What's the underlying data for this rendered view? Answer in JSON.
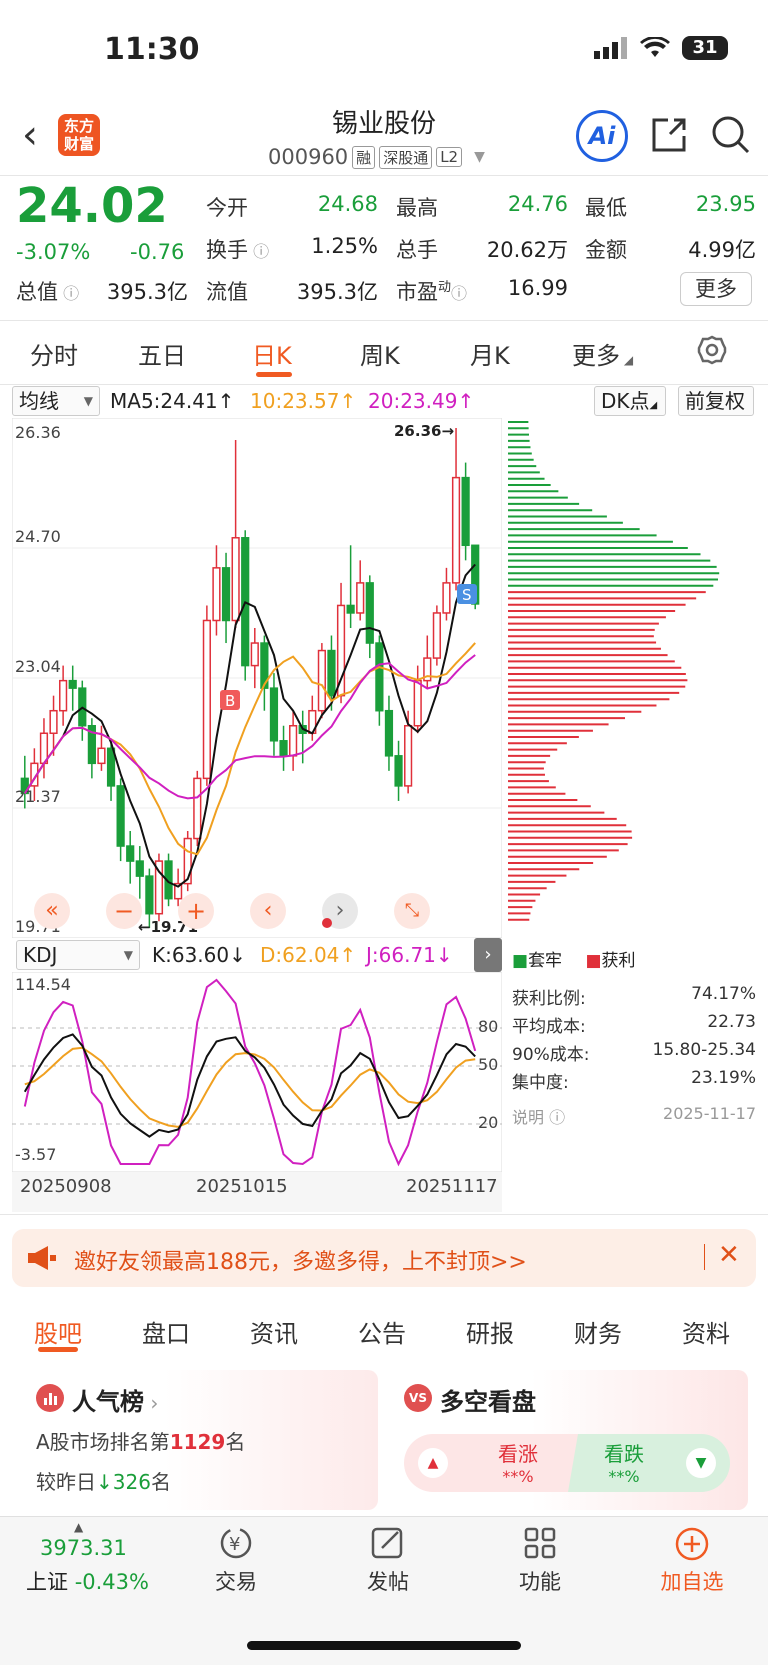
{
  "status": {
    "time": "11:30",
    "battery": "31"
  },
  "header": {
    "logo_line1": "东方",
    "logo_line2": "财富",
    "name": "锡业股份",
    "code": "000960",
    "tags": [
      "融",
      "深股通",
      "L2"
    ],
    "ai_label": "Ai"
  },
  "quote": {
    "price": "24.02",
    "pct": "-3.07%",
    "chg": "-0.76",
    "open_label": "今开",
    "open": "24.68",
    "high_label": "最高",
    "high": "24.76",
    "low_label": "最低",
    "low": "23.95",
    "turnover_label": "换手",
    "turnover": "1.25%",
    "volume_label": "总手",
    "volume": "20.62万",
    "amount_label": "金额",
    "amount": "4.99亿",
    "mktcap_label": "总值",
    "mktcap": "395.3亿",
    "float_label": "流值",
    "float": "395.3亿",
    "pe_label": "市盈",
    "pe_sup": "动",
    "pe": "16.99",
    "more": "更多"
  },
  "period_tabs": [
    "分时",
    "五日",
    "日K",
    "周K",
    "月K",
    "更多"
  ],
  "chart_toolbar": {
    "ma_select": "均线",
    "ma5": "MA5:24.41",
    "ma10": "10:23.57",
    "ma20": "20:23.49",
    "dk": "DK点",
    "adjust": "前复权"
  },
  "kline_axis": {
    "top": "26.36",
    "mid1": "24.70",
    "mid2": "23.04",
    "mid3": "21.37",
    "bottom": "19.71",
    "high_mark": "26.36→",
    "low_mark": "←19.71"
  },
  "kdj": {
    "select": "KDJ",
    "k": "K:63.60",
    "d": "D:62.04",
    "j": "J:66.71",
    "ymax": "114.54",
    "ymin": "-3.57",
    "l80": "80",
    "l50": "50",
    "l20": "20",
    "dates": [
      "20250908",
      "20251015",
      "20251117"
    ]
  },
  "chips": {
    "legend_lock": "套牢",
    "legend_profit": "获利",
    "rows": [
      {
        "label": "获利比例:",
        "value": "74.17%"
      },
      {
        "label": "平均成本:",
        "value": "22.73"
      },
      {
        "label": "90%成本:",
        "value": "15.80-25.34"
      },
      {
        "label": "集中度:",
        "value": "23.19%"
      }
    ],
    "note": "说明",
    "date": "2025-11-17"
  },
  "promo": {
    "text": "邀好友领最高188元，多邀多得，上不封顶>>"
  },
  "bottom_tabs": [
    "股吧",
    "盘口",
    "资讯",
    "公告",
    "研报",
    "财务",
    "资料"
  ],
  "popularity": {
    "title": "人气榜",
    "rank_prefix": "A股市场排名第",
    "rank": "1129",
    "rank_suffix": "名",
    "delta_prefix": "较昨日",
    "delta": "326",
    "delta_suffix": "名"
  },
  "bullbear": {
    "title": "多空看盘",
    "up": "看涨",
    "up_val": "**%",
    "down": "看跌",
    "down_val": "**%"
  },
  "nav": {
    "index_value": "3973.31",
    "index_name": "上证",
    "index_pct": "-0.43%",
    "items": [
      "交易",
      "发帖",
      "功能",
      "加自选"
    ]
  },
  "colors": {
    "up": "#e0303a",
    "down": "#1a9e3a",
    "accent": "#f05a22"
  },
  "chart_data": [
    {
      "type": "candlestick",
      "ylim": [
        19.71,
        26.36
      ],
      "series": [
        {
          "name": "MA5",
          "value": 24.41
        },
        {
          "name": "MA10",
          "value": 23.57
        },
        {
          "name": "MA20",
          "value": 23.49
        }
      ],
      "candles": [
        [
          21.7,
          21.5,
          22.0,
          21.3
        ],
        [
          21.6,
          21.9,
          22.1,
          21.4
        ],
        [
          21.9,
          22.3,
          22.5,
          21.7
        ],
        [
          22.3,
          22.6,
          22.8,
          22.0
        ],
        [
          22.6,
          23.0,
          23.2,
          22.4
        ],
        [
          23.0,
          22.9,
          23.2,
          22.6
        ],
        [
          22.9,
          22.4,
          23.0,
          22.2
        ],
        [
          22.4,
          21.9,
          22.5,
          21.7
        ],
        [
          21.9,
          22.1,
          22.4,
          21.8
        ],
        [
          22.1,
          21.6,
          22.2,
          21.4
        ],
        [
          21.6,
          20.8,
          21.7,
          20.6
        ],
        [
          20.8,
          20.6,
          21.0,
          20.3
        ],
        [
          20.6,
          20.4,
          20.8,
          20.1
        ],
        [
          20.4,
          19.9,
          20.5,
          19.71
        ],
        [
          19.9,
          20.6,
          20.7,
          19.8
        ],
        [
          20.6,
          20.1,
          20.7,
          20.0
        ],
        [
          20.1,
          20.3,
          20.5,
          20.0
        ],
        [
          20.3,
          20.9,
          21.0,
          20.2
        ],
        [
          20.9,
          21.7,
          21.8,
          20.8
        ],
        [
          21.7,
          23.8,
          24.0,
          21.6
        ],
        [
          23.8,
          24.5,
          24.8,
          23.6
        ],
        [
          24.5,
          23.8,
          24.7,
          23.5
        ],
        [
          23.8,
          24.9,
          26.2,
          23.7
        ],
        [
          24.9,
          23.2,
          25.0,
          23.0
        ],
        [
          23.2,
          23.5,
          23.7,
          22.9
        ],
        [
          23.5,
          22.9,
          23.6,
          22.6
        ],
        [
          22.9,
          22.2,
          23.1,
          22.0
        ],
        [
          22.2,
          22.0,
          22.4,
          21.8
        ],
        [
          22.0,
          22.4,
          22.6,
          21.8
        ],
        [
          22.4,
          22.3,
          22.6,
          21.9
        ],
        [
          22.3,
          22.6,
          22.8,
          22.2
        ],
        [
          22.6,
          23.4,
          23.5,
          22.5
        ],
        [
          23.4,
          22.8,
          23.6,
          22.6
        ],
        [
          22.8,
          24.0,
          24.3,
          22.7
        ],
        [
          24.0,
          23.9,
          24.8,
          23.7
        ],
        [
          23.9,
          24.3,
          24.6,
          23.8
        ],
        [
          24.3,
          23.5,
          24.4,
          23.3
        ],
        [
          23.5,
          22.6,
          23.6,
          22.4
        ],
        [
          22.6,
          22.0,
          22.8,
          21.8
        ],
        [
          22.0,
          21.6,
          22.2,
          21.4
        ],
        [
          21.6,
          22.4,
          22.6,
          21.5
        ],
        [
          22.4,
          23.0,
          23.2,
          22.3
        ],
        [
          23.0,
          23.3,
          23.6,
          22.9
        ],
        [
          23.3,
          23.9,
          24.0,
          23.2
        ],
        [
          23.9,
          24.3,
          24.5,
          23.8
        ],
        [
          24.3,
          25.7,
          26.36,
          24.2
        ],
        [
          25.7,
          24.8,
          25.9,
          24.6
        ],
        [
          24.8,
          24.02,
          24.76,
          23.95
        ]
      ]
    },
    {
      "type": "line",
      "title": "KDJ",
      "ylim": [
        -3.57,
        114.54
      ],
      "series": [
        {
          "name": "K",
          "value": 63.6
        },
        {
          "name": "D",
          "value": 62.04
        },
        {
          "name": "J",
          "value": 66.71
        }
      ]
    }
  ]
}
